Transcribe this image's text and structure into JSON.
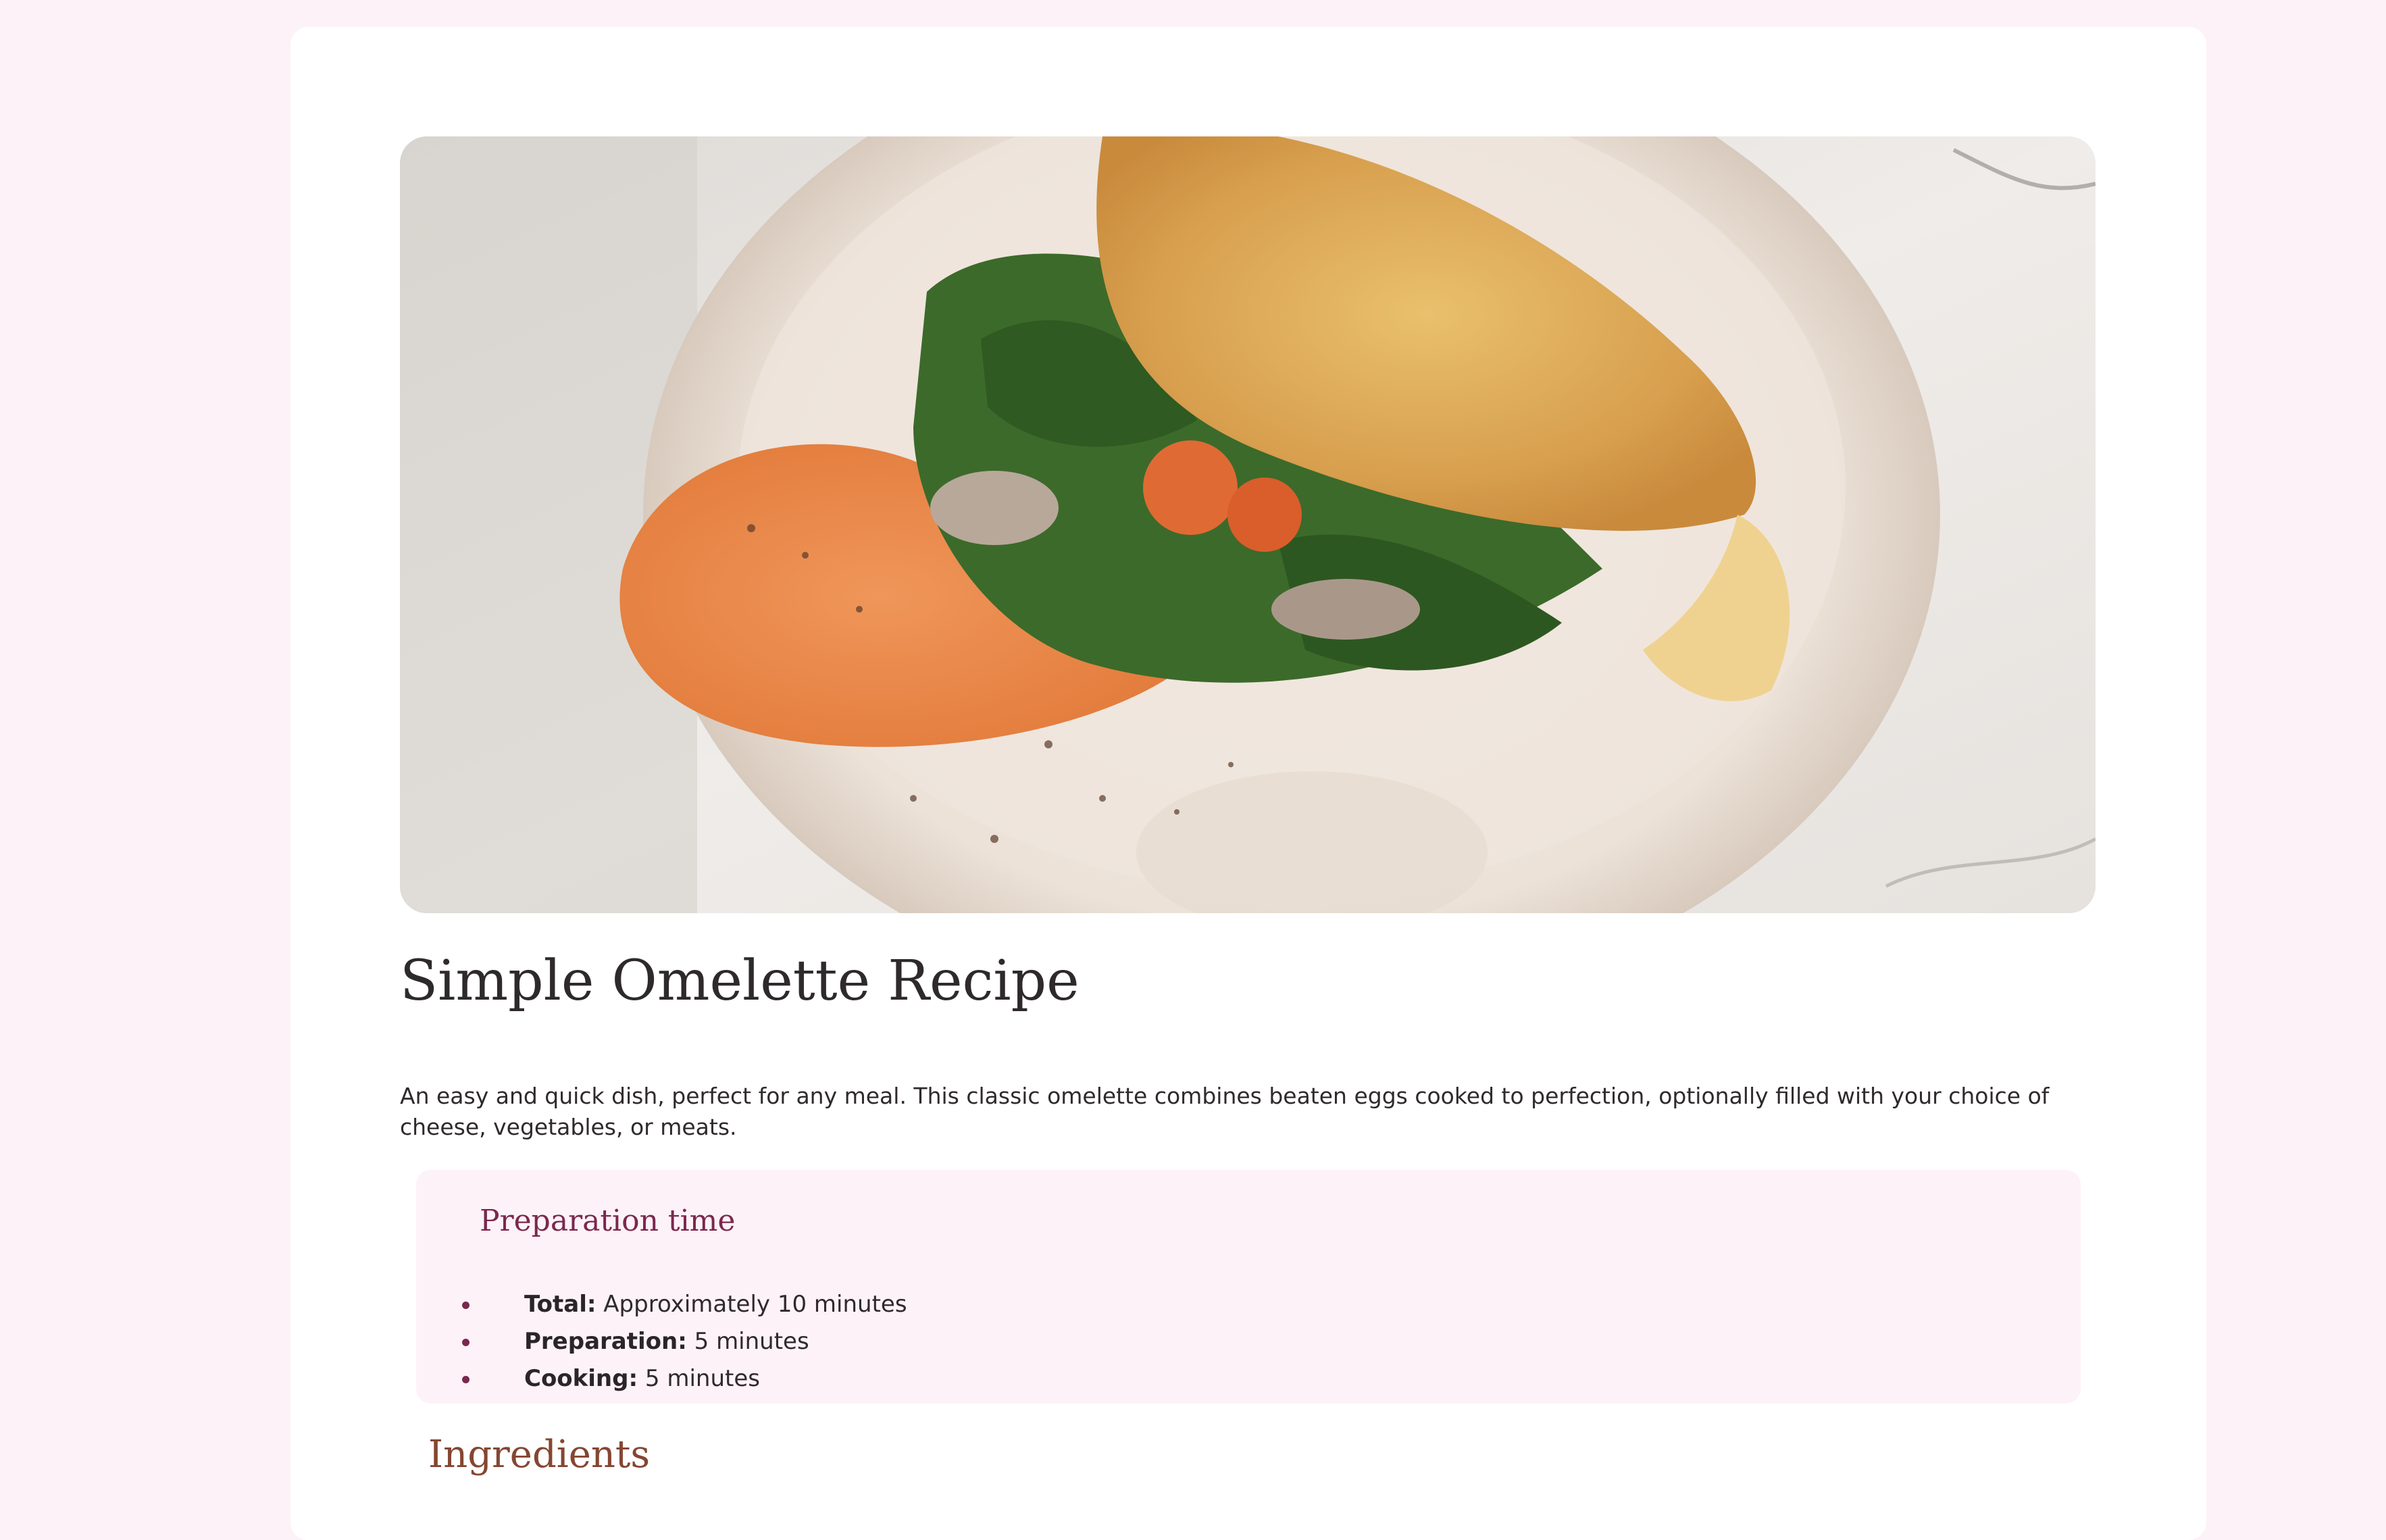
{
  "recipe": {
    "title": "Simple Omelette Recipe",
    "intro": "An easy and quick dish, perfect for any meal. This classic omelette combines beaten eggs cooked to perfection, optionally filled with your choice of cheese, vegetables, or meats."
  },
  "preparation": {
    "heading": "Preparation time",
    "items": [
      {
        "label": "Total:",
        "value": "Approximately 10 minutes"
      },
      {
        "label": "Preparation:",
        "value": "5 minutes"
      },
      {
        "label": "Cooking:",
        "value": "5 minutes"
      }
    ]
  },
  "ingredients": {
    "heading": "Ingredients"
  },
  "colors": {
    "page_background": "#fdf2f7",
    "card_background": "#ffffff",
    "heading_dark": "#2e2a2b",
    "preparation_accent": "#7a284e",
    "ingredients_accent": "#854632",
    "preparation_panel": "#fdf2f7"
  }
}
